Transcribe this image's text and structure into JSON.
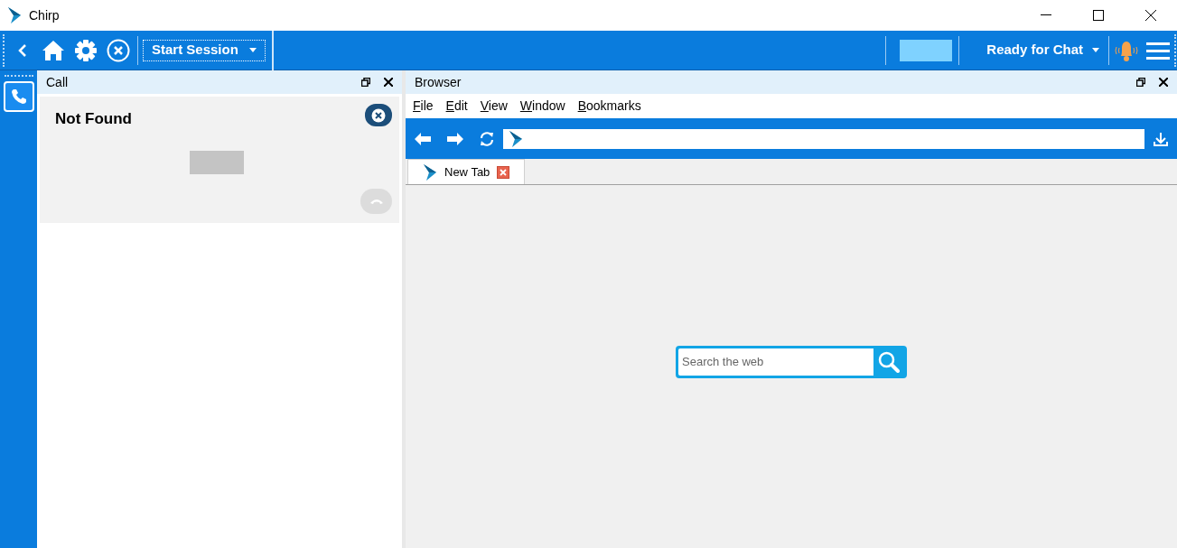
{
  "window": {
    "title": "Chirp"
  },
  "toolbar": {
    "session_dropdown": "Start Session",
    "status_dropdown": "Ready for Chat"
  },
  "call_panel": {
    "title": "Call",
    "card": {
      "title": "Not Found"
    }
  },
  "browser_panel": {
    "title": "Browser",
    "menu": [
      "File",
      "Edit",
      "View",
      "Window",
      "Bookmarks"
    ],
    "tabs": [
      {
        "label": "New Tab",
        "selected": true
      }
    ],
    "search": {
      "placeholder": "Search the web"
    }
  }
}
